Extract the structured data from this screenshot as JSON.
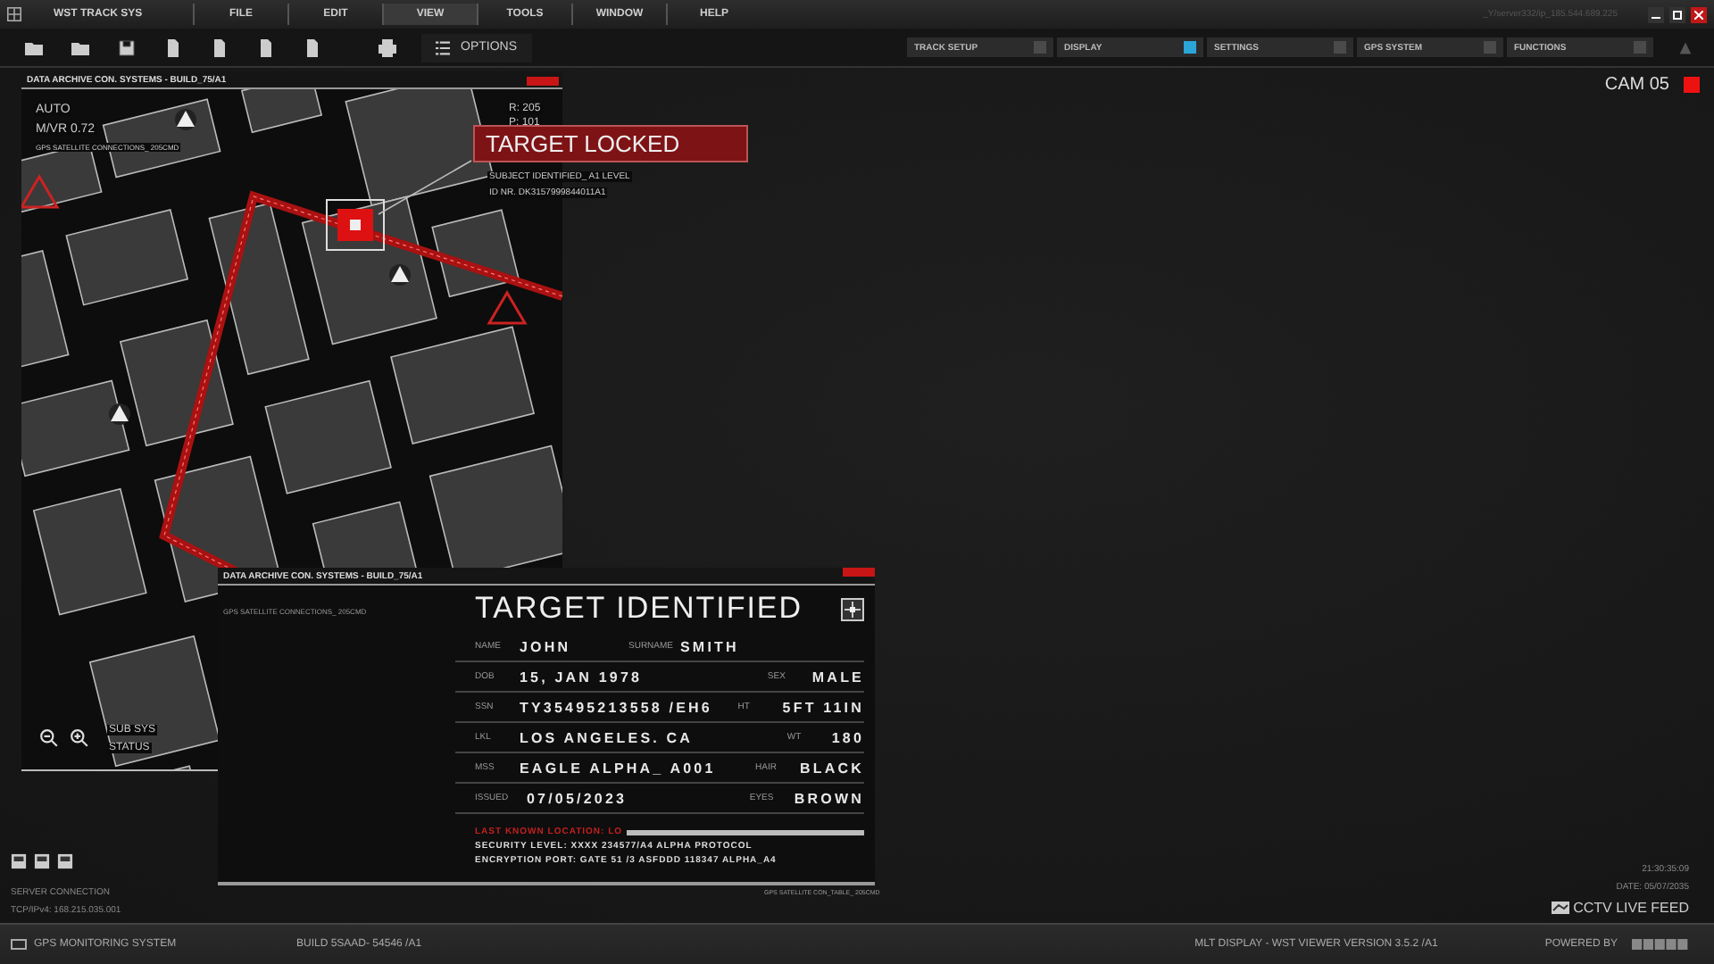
{
  "menu": {
    "title": "WST TRACK SYS",
    "items": [
      {
        "label": "FILE",
        "selected": false
      },
      {
        "label": "EDIT",
        "selected": false
      },
      {
        "label": "VIEW",
        "selected": true
      },
      {
        "label": "TOOLS",
        "selected": false
      },
      {
        "label": "WINDOW",
        "selected": false
      },
      {
        "label": "HELP",
        "selected": false
      }
    ],
    "server": "_Y/server332/ip_185.544.689.225"
  },
  "toolbar": {
    "options_label": "OPTIONS",
    "toggles": [
      {
        "label": "TRACK SETUP",
        "on": false
      },
      {
        "label": "DISPLAY",
        "on": true
      },
      {
        "label": "SETTINGS",
        "on": false
      },
      {
        "label": "GPS SYSTEM",
        "on": false
      },
      {
        "label": "FUNCTIONS",
        "on": false
      }
    ]
  },
  "camera": {
    "label": "CAM 05",
    "recording": true
  },
  "map_window": {
    "title": "DATA ARCHIVE CON. SYSTEMS - BUILD_75/A1",
    "readouts": [
      "AUTO",
      "M/VR 0.72"
    ],
    "subtitle": "GPS SATELLITE CONNECTIONS_ 205CMD",
    "coords": [
      "R: 205",
      "P: 101"
    ],
    "status_lines": [
      "SUB SYS",
      "STATUS"
    ]
  },
  "target_locked": {
    "title": "TARGET LOCKED",
    "lines": [
      "SUBJECT IDENTIFIED_ A1 LEVEL",
      "ID NR. DK3157999844011A1"
    ]
  },
  "card": {
    "title": "DATA ARCHIVE CON. SYSTEMS - BUILD_75/A1",
    "subtitle": "GPS SATELLITE CONNECTIONS_ 205CMD",
    "heading": "TARGET IDENTIFIED",
    "name_label": "NAME",
    "name": "JOHN",
    "surname_label": "SURNAME",
    "surname": "SMITH",
    "rows": [
      {
        "label": "DOB",
        "value": "15, JAN 1978",
        "label_2": "SEX",
        "value_2": "MALE"
      },
      {
        "label": "SSN",
        "value": "TY35495213558 /EH6",
        "label_2": "HT",
        "value_2": "5FT 11IN"
      },
      {
        "label": "LKL",
        "value": "LOS ANGELES. CA",
        "label_2": "WT",
        "value_2": "180"
      },
      {
        "label": "MSS",
        "value": "EAGLE ALPHA_ A001",
        "label_2": "HAIR",
        "value_2": "BLACK"
      },
      {
        "label": "ISSUED",
        "value": "07/05/2023",
        "label_2": "EYES",
        "value_2": "BROWN"
      }
    ],
    "location_label": "LAST KNOWN LOCATION: LO",
    "notes": [
      "SECURITY LEVEL: XXXX 234577/A4 ALPHA PROTOCOL",
      "ENCRYPTION PORT: GATE 51 /3 ASFDDD 118347 ALPHA_A4"
    ],
    "footer": "GPS SATELLITE CON_TABLE_ 205CMD"
  },
  "server_info": {
    "label": "SERVER CONNECTION",
    "address": "TCP/IPv4: 168.215.035.001"
  },
  "clock": {
    "time": "21:30:35:09",
    "date": "DATE: 05/07/2035",
    "feed": "CCTV LIVE FEED"
  },
  "status_bar": {
    "system": "GPS MONITORING SYSTEM",
    "build": "BUILD 5SAAD- 54546 /A1",
    "version": "MLT DISPLAY - WST VIEWER VERSION 3.5.2 /A1",
    "powered_by": "POWERED BY"
  }
}
